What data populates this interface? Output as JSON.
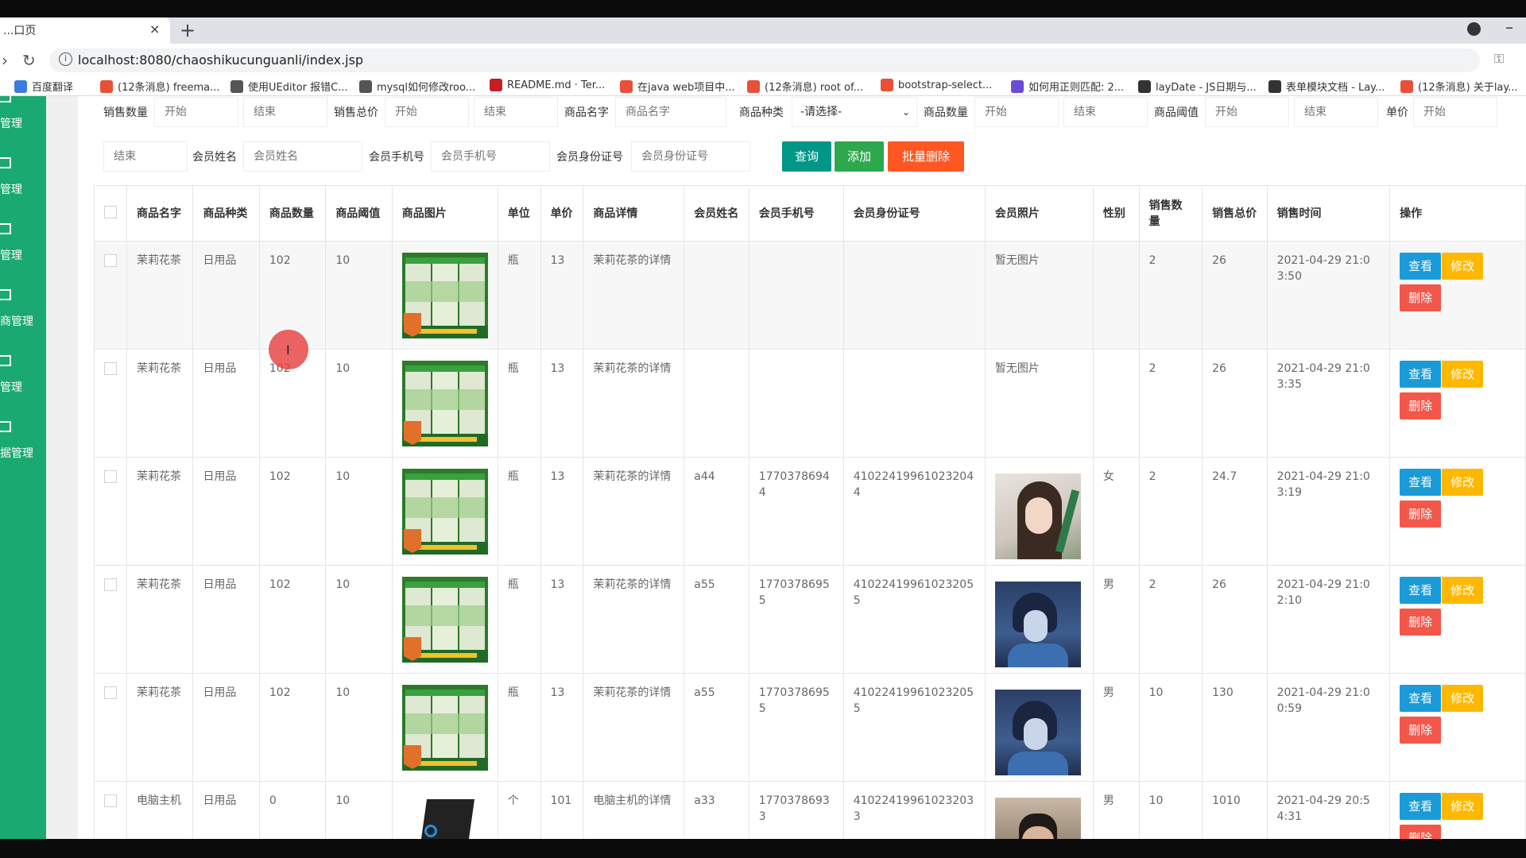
{
  "browser": {
    "tab_title": "...口页",
    "tab_close": "×",
    "new_tab": "+",
    "url": "localhost:8080/chaoshikucunguanli/index.jsp",
    "bookmarks": [
      {
        "label": "百度翻译",
        "icon": "translate-icon",
        "color": "#3b7ddd"
      },
      {
        "label": "(12条消息) freema...",
        "icon": "csdn-icon",
        "color": "#e8503a"
      },
      {
        "label": "使用UEditor 报错C...",
        "icon": "yuque-icon",
        "color": "#555555"
      },
      {
        "label": "mysql如何修改roo...",
        "icon": "yuque-icon",
        "color": "#555555"
      },
      {
        "label": "README.md · Ter...",
        "icon": "gitee-icon",
        "color": "#c71d23"
      },
      {
        "label": "在java web项目中...",
        "icon": "csdn-icon",
        "color": "#e8503a"
      },
      {
        "label": "(12条消息) root of...",
        "icon": "csdn-icon",
        "color": "#e8503a"
      },
      {
        "label": "bootstrap-select...",
        "icon": "bookmark-icon",
        "color": "#e8503a"
      },
      {
        "label": "如何用正则匹配: 2...",
        "icon": "gear-icon",
        "color": "#6a4bd8"
      },
      {
        "label": "layDate - JS日期与...",
        "icon": "layui-icon",
        "color": "#333333"
      },
      {
        "label": "表单模块文档 - Lay...",
        "icon": "layui-icon",
        "color": "#333333"
      },
      {
        "label": "(12条消息) 关于lay...",
        "icon": "csdn-icon",
        "color": "#e8503a"
      }
    ]
  },
  "sidebar": {
    "items": [
      {
        "label": "管理"
      },
      {
        "label": "管理"
      },
      {
        "label": "管理"
      },
      {
        "label": "商管理"
      },
      {
        "label": "管理"
      },
      {
        "label": "据管理"
      }
    ]
  },
  "filters": {
    "row1": [
      {
        "label": "销售数量",
        "inputs": [
          "开始",
          "结束"
        ]
      },
      {
        "label": "销售总价",
        "inputs": [
          "开始",
          "结束"
        ]
      },
      {
        "label": "商品名字",
        "inputs": [
          "商品名字"
        ]
      },
      {
        "label": "商品种类",
        "select": "-请选择-"
      },
      {
        "label": "商品数量",
        "inputs": [
          "开始",
          "结束"
        ]
      },
      {
        "label": "商品阈值",
        "inputs": [
          "开始",
          "结束"
        ]
      },
      {
        "label": "单价",
        "inputs": [
          "开始"
        ]
      }
    ],
    "row2_first_input": "结束",
    "member_name_label": "会员姓名",
    "member_name_placeholder": "会员姓名",
    "member_phone_label": "会员手机号",
    "member_phone_placeholder": "会员手机号",
    "member_id_label": "会员身份证号",
    "member_id_placeholder": "会员身份证号",
    "query_button": "查询",
    "add_button": "添加",
    "batch_delete_button": "批量删除"
  },
  "table": {
    "headers": [
      "商品名字",
      "商品种类",
      "商品数量",
      "商品阈值",
      "商品图片",
      "单位",
      "单价",
      "商品详情",
      "会员姓名",
      "会员手机号",
      "会员身份证号",
      "会员照片",
      "性别",
      "销售数量",
      "销售总价",
      "销售时间",
      "操作"
    ],
    "rows": [
      {
        "name": "茉莉花茶",
        "category": "日用品",
        "qty": "102",
        "threshold": "10",
        "image": "tea",
        "unit": "瓶",
        "price": "13",
        "detail": "茉莉花茶的详情",
        "member_name": "",
        "phone": "",
        "id_card": "",
        "photo_text": "暂无图片",
        "photo": "",
        "gender": "",
        "sale_qty": "2",
        "sale_total": "26",
        "sale_time": "2021-04-29 21:03:50"
      },
      {
        "name": "茉莉花茶",
        "category": "日用品",
        "qty": "102",
        "threshold": "10",
        "image": "tea",
        "unit": "瓶",
        "price": "13",
        "detail": "茉莉花茶的详情",
        "member_name": "",
        "phone": "",
        "id_card": "",
        "photo_text": "暂无图片",
        "photo": "",
        "gender": "",
        "sale_qty": "2",
        "sale_total": "26",
        "sale_time": "2021-04-29 21:03:35"
      },
      {
        "name": "茉莉花茶",
        "category": "日用品",
        "qty": "102",
        "threshold": "10",
        "image": "tea",
        "unit": "瓶",
        "price": "13",
        "detail": "茉莉花茶的详情",
        "member_name": "a44",
        "phone": "17703786944",
        "id_card": "410224199610232044",
        "photo_text": "",
        "photo": "female",
        "gender": "女",
        "sale_qty": "2",
        "sale_total": "24.7",
        "sale_time": "2021-04-29 21:03:19"
      },
      {
        "name": "茉莉花茶",
        "category": "日用品",
        "qty": "102",
        "threshold": "10",
        "image": "tea",
        "unit": "瓶",
        "price": "13",
        "detail": "茉莉花茶的详情",
        "member_name": "a55",
        "phone": "17703786955",
        "id_card": "410224199610232055",
        "photo_text": "",
        "photo": "male-anime",
        "gender": "男",
        "sale_qty": "2",
        "sale_total": "26",
        "sale_time": "2021-04-29 21:02:10"
      },
      {
        "name": "茉莉花茶",
        "category": "日用品",
        "qty": "102",
        "threshold": "10",
        "image": "tea",
        "unit": "瓶",
        "price": "13",
        "detail": "茉莉花茶的详情",
        "member_name": "a55",
        "phone": "17703786955",
        "id_card": "410224199610232055",
        "photo_text": "",
        "photo": "male-anime",
        "gender": "男",
        "sale_qty": "10",
        "sale_total": "130",
        "sale_time": "2021-04-29 21:00:59"
      },
      {
        "name": "电脑主机",
        "category": "日用品",
        "qty": "0",
        "threshold": "10",
        "image": "pc",
        "unit": "个",
        "price": "101",
        "detail": "电脑主机的详情",
        "member_name": "a33",
        "phone": "17703786933",
        "id_card": "410224199610232033",
        "photo_text": "",
        "photo": "male-photo",
        "gender": "男",
        "sale_qty": "10",
        "sale_total": "1010",
        "sale_time": "2021-04-29 20:54:31"
      }
    ],
    "actions": {
      "view": "查看",
      "edit": "修改",
      "delete": "删除"
    }
  },
  "colors": {
    "sidebar": "#1aa971",
    "query": "#009688",
    "add": "#2ea84e",
    "danger": "#ff5722",
    "view": "#1a9bd7",
    "edit": "#ffb800"
  }
}
